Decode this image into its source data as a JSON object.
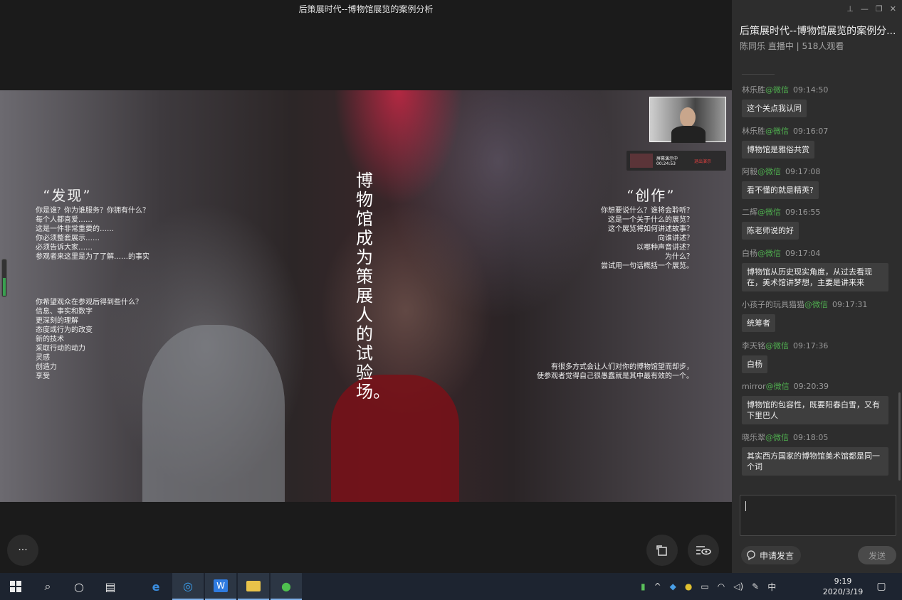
{
  "video": {
    "title": "后策展时代--博物馆展览的案例分析",
    "slide": {
      "vertical_text": "博物馆成为策展人的试验场。",
      "left_heading": "“发现”",
      "left_lines": "你是谁？你为谁服务？你拥有什么？\n每个人都喜爱……\n这是一件非常重要的……\n你必须整套展示……\n必须告诉大家……\n参观者来这里是为了了解……的事实",
      "left_lines2": "你希望观众在参观后得到些什么？\n信息、事实和数字\n更深刻的理解\n态度或行为的改变\n新的技术\n采取行动的动力\n灵感\n创造力\n享受",
      "right_heading": "“创作”",
      "right_lines": "你想要说什么？谁将会聆听？\n这是一个关于什么的展览？\n这个展览将如何讲述故事？\n向谁讲述？\n以哪种声音讲述？\n为什么？\n尝试用一句话概括一个展览。",
      "right_bottom": "有很多方式会让人们对你的博物馆望而却步，\n使参观者觉得自己很愚蠢就是其中最有效的一个。"
    },
    "screen_share": {
      "status": "屏幕演示中",
      "time": "00:24:53",
      "stop": "退出演示"
    },
    "volume_level": 0.5,
    "more_label": "···",
    "rotate_icon": "rotate-icon",
    "view_icon": "eye-icon"
  },
  "panel": {
    "title": "后策展时代--博物馆展览的案例分...",
    "subtitle": "陈同乐 直播中 | 518人观看",
    "controls": [
      "pin-icon",
      "minimize-icon",
      "restore-icon",
      "close-icon"
    ],
    "messages": [
      {
        "user": "林乐胜",
        "source": "@微信",
        "time": "09:14:50",
        "text": "这个关点我认同"
      },
      {
        "user": "林乐胜",
        "source": "@微信",
        "time": "09:16:07",
        "text": "博物馆是雅俗共赏"
      },
      {
        "user": "阿毅",
        "source": "@微信",
        "time": "09:17:08",
        "text": "看不懂的就是精英?"
      },
      {
        "user": "二辉",
        "source": "@微信",
        "time": "09:16:55",
        "text": "陈老师说的好"
      },
      {
        "user": "白杨",
        "source": "@微信",
        "time": "09:17:04",
        "text": "博物馆从历史现实角度，从过去看现在，美术馆讲梦想，主要是讲来来"
      },
      {
        "user": "小孩子的玩具猫猫",
        "source": "@微信",
        "time": "09:17:31",
        "text": "统筹者"
      },
      {
        "user": "李天铭",
        "source": "@微信",
        "time": "09:17:36",
        "text": "白杨"
      },
      {
        "user": "mirror",
        "source": "@微信",
        "time": "09:20:39",
        "text": "博物馆的包容性，既要阳春白雪，又有下里巴人"
      },
      {
        "user": "晓乐翠",
        "source": "@微信",
        "time": "09:18:05",
        "text": "其实西方国家的博物馆美术馆都是同一个词"
      }
    ],
    "input_placeholder": "",
    "apply_label": "申请发言",
    "send_label": "发送"
  },
  "taskbar": {
    "apps": [
      "windows-start-icon",
      "search-icon",
      "cortana-icon",
      "task-view-icon",
      "edge-icon",
      "tencent-meeting-icon",
      "wps-icon",
      "file-explorer-icon",
      "wechat-icon"
    ],
    "ime": "中",
    "time": "9:19",
    "date": "2020/3/19"
  }
}
